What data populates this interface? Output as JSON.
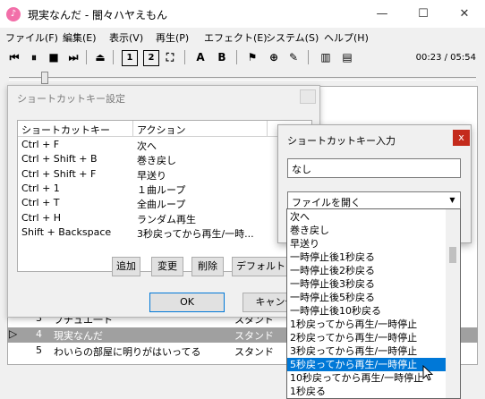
{
  "window": {
    "title": "現実なんだ - 闇々ハヤえもん",
    "app_icon": "♪",
    "minimize": "—",
    "maximize": "☐",
    "close": "✕"
  },
  "menu": [
    "ファイル(F)",
    "編集(E)",
    "表示(V)",
    "再生(P)",
    "エフェクト(E)",
    "システム(S)",
    "ヘルプ(H)"
  ],
  "toolbar": {
    "time": "00:23 / 05:54",
    "buttons": [
      "⏮",
      "⏸",
      "■",
      "⏭",
      "⏏",
      "1",
      "2",
      "⛶",
      "A",
      "B",
      "⚑",
      "⊕",
      "✎",
      "▥",
      "▤"
    ]
  },
  "background_rows": [
    {
      "no": "3",
      "title": "ブチュエ一ト",
      "artist": "スタンド"
    },
    {
      "no": "4",
      "title": "現実なんだ",
      "artist": "スタンド"
    },
    {
      "no": "5",
      "title": "わいらの部屋に明りがはいってる",
      "artist": "スタンド"
    }
  ],
  "play_marker": "▷",
  "shortcut_dialog": {
    "title": "ショートカットキー設定",
    "columns": [
      "ショートカットキー",
      "アクション"
    ],
    "rows": [
      {
        "key": "Ctrl + F",
        "action": "次へ"
      },
      {
        "key": "Ctrl + Shift + B",
        "action": "巻き戻し"
      },
      {
        "key": "Ctrl + Shift + F",
        "action": "早送り"
      },
      {
        "key": "Ctrl + 1",
        "action": "１曲ループ"
      },
      {
        "key": "Ctrl + T",
        "action": "全曲ループ"
      },
      {
        "key": "Ctrl + H",
        "action": "ランダム再生"
      },
      {
        "key": "Shift + Backspace",
        "action": "3秒戻ってから再生/一時..."
      }
    ],
    "buttons": {
      "add": "追加",
      "edit": "変更",
      "delete": "削除",
      "default": "デフォルトの",
      "ok": "OK",
      "cancel": "キャンセル"
    }
  },
  "input_dialog": {
    "title": "ショートカットキー入力",
    "close": "x",
    "key_value": "なし",
    "combo_value": "ファイルを開く",
    "combo_arrow": "▼"
  },
  "dropdown_options": [
    "次へ",
    "巻き戻し",
    "早送り",
    "一時停止後1秒戻る",
    "一時停止後2秒戻る",
    "一時停止後3秒戻る",
    "一時停止後5秒戻る",
    "一時停止後10秒戻る",
    "1秒戻ってから再生/一時停止",
    "2秒戻ってから再生/一時停止",
    "3秒戻ってから再生/一時停止",
    "5秒戻ってから再生/一時停止",
    "10秒戻ってから再生/一時停止",
    "1秒戻る"
  ],
  "selected_option_index": 11,
  "colors": {
    "selection": "#0078d7",
    "close_red": "#c42b1c",
    "app_icon": "#f26fa9"
  }
}
